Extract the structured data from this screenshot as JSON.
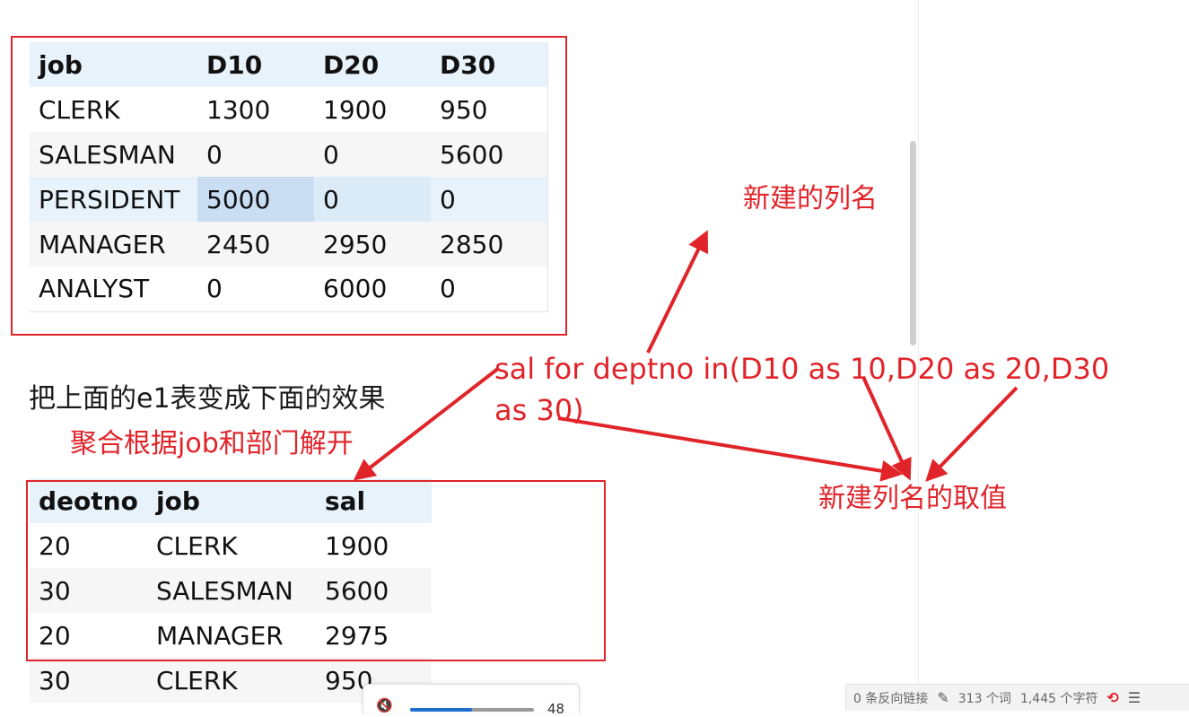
{
  "table_top": {
    "headers": [
      "job",
      "D10",
      "D20",
      "D30"
    ],
    "rows": [
      [
        "CLERK",
        "1300",
        "1900",
        "950"
      ],
      [
        "SALESMAN",
        "0",
        "0",
        "5600"
      ],
      [
        "PERSIDENT",
        "5000",
        "0",
        "0"
      ],
      [
        "MANAGER",
        "2450",
        "2950",
        "2850"
      ],
      [
        "ANALYST",
        "0",
        "6000",
        "0"
      ]
    ]
  },
  "captions": {
    "transform": "把上面的e1表变成下面的效果",
    "aggregate": "聚合根据job和部门解开",
    "new_column_name": "新建的列名",
    "new_column_values": "新建列名的取值",
    "code": "sal for deptno in(D10 as 10,D20 as 20,D30 as 30)"
  },
  "table_bottom": {
    "headers": [
      "deotno",
      "job",
      "sal"
    ],
    "rows": [
      [
        "20",
        "CLERK",
        "1900"
      ],
      [
        "30",
        "SALESMAN",
        "5600"
      ],
      [
        "20",
        "MANAGER",
        "2975"
      ],
      [
        "30",
        "CLERK",
        "950"
      ]
    ]
  },
  "status_bar": {
    "backlinks": "0 条反向链接",
    "words": "313 个词",
    "chars": "1,445 个字符",
    "edit_icon": "pencil-icon",
    "sync_icon": "sync-off-icon",
    "outline_icon": "outline-icon"
  },
  "media": {
    "mute_icon": "speaker-mute-icon",
    "volume": "48",
    "progress_fraction": 0.5
  },
  "colors": {
    "annotation_red": "#e0242a",
    "header_bg": "#e8f2fb",
    "selected_cell": "#c9def3"
  }
}
